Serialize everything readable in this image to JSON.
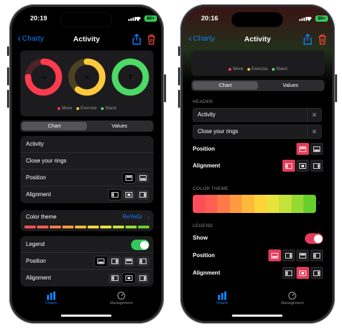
{
  "left_phone": {
    "status": {
      "time": "20:19",
      "battery": "80+"
    },
    "nav": {
      "back_label": "Charty",
      "title": "Activity"
    },
    "preview_legend": [
      {
        "label": "Move",
        "color": "#ff3b4e"
      },
      {
        "label": "Exercise",
        "color": "#ffc93c"
      },
      {
        "label": "Stand",
        "color": "#4cd964"
      }
    ],
    "rings": [
      {
        "name": "Move",
        "color": "#ff3b4e",
        "fraction": 0.75,
        "glyph": "→"
      },
      {
        "name": "Exercise",
        "color": "#ffc93c",
        "fraction": 0.6,
        "glyph": "»"
      },
      {
        "name": "Stand",
        "color": "#4cd964",
        "fraction": 1.0,
        "glyph": "↑"
      }
    ],
    "segment": {
      "options": [
        "Chart",
        "Values"
      ],
      "selected": "Chart"
    },
    "header_group": {
      "title": "Activity",
      "subtitle": "Close your rings",
      "position_label": "Position",
      "alignment_label": "Alignment"
    },
    "color_theme": {
      "label": "Color theme",
      "value": "ReYeGr"
    },
    "legend_group": {
      "legend_label": "Legend",
      "legend_on": true,
      "position_label": "Position",
      "alignment_label": "Alignment"
    },
    "tabbar": {
      "charts": "Charts",
      "management": "Management"
    }
  },
  "right_phone": {
    "status": {
      "time": "20:16",
      "battery": "80+"
    },
    "nav": {
      "back_label": "Charty",
      "title": "Activity"
    },
    "preview_legend": [
      {
        "label": "Move",
        "color": "#ff3b4e"
      },
      {
        "label": "Exercise",
        "color": "#ffc93c"
      },
      {
        "label": "Stand",
        "color": "#4cd964"
      }
    ],
    "segment": {
      "options": [
        "Chart",
        "Values"
      ],
      "selected": "Chart"
    },
    "header_section": {
      "heading": "HEADER",
      "title_value": "Activity",
      "subtitle_value": "Close your rings",
      "position_label": "Position",
      "alignment_label": "Alignment"
    },
    "color_section": {
      "heading": "COLOR THEME"
    },
    "legend_section": {
      "heading": "LEGEND",
      "show_label": "Show",
      "show_on": true,
      "position_label": "Position",
      "alignment_label": "Alignment"
    },
    "tabbar": {
      "charts": "Charts",
      "management": "Management"
    }
  },
  "theme_colors": [
    "#ff4d5a",
    "#ff5f52",
    "#ff7a48",
    "#ff9a40",
    "#ffb93a",
    "#ffd43a",
    "#e8e33a",
    "#c3e23a",
    "#94da32",
    "#65cf2c"
  ],
  "accent": "#0a84ff",
  "selected_accent": "#e33c5a"
}
